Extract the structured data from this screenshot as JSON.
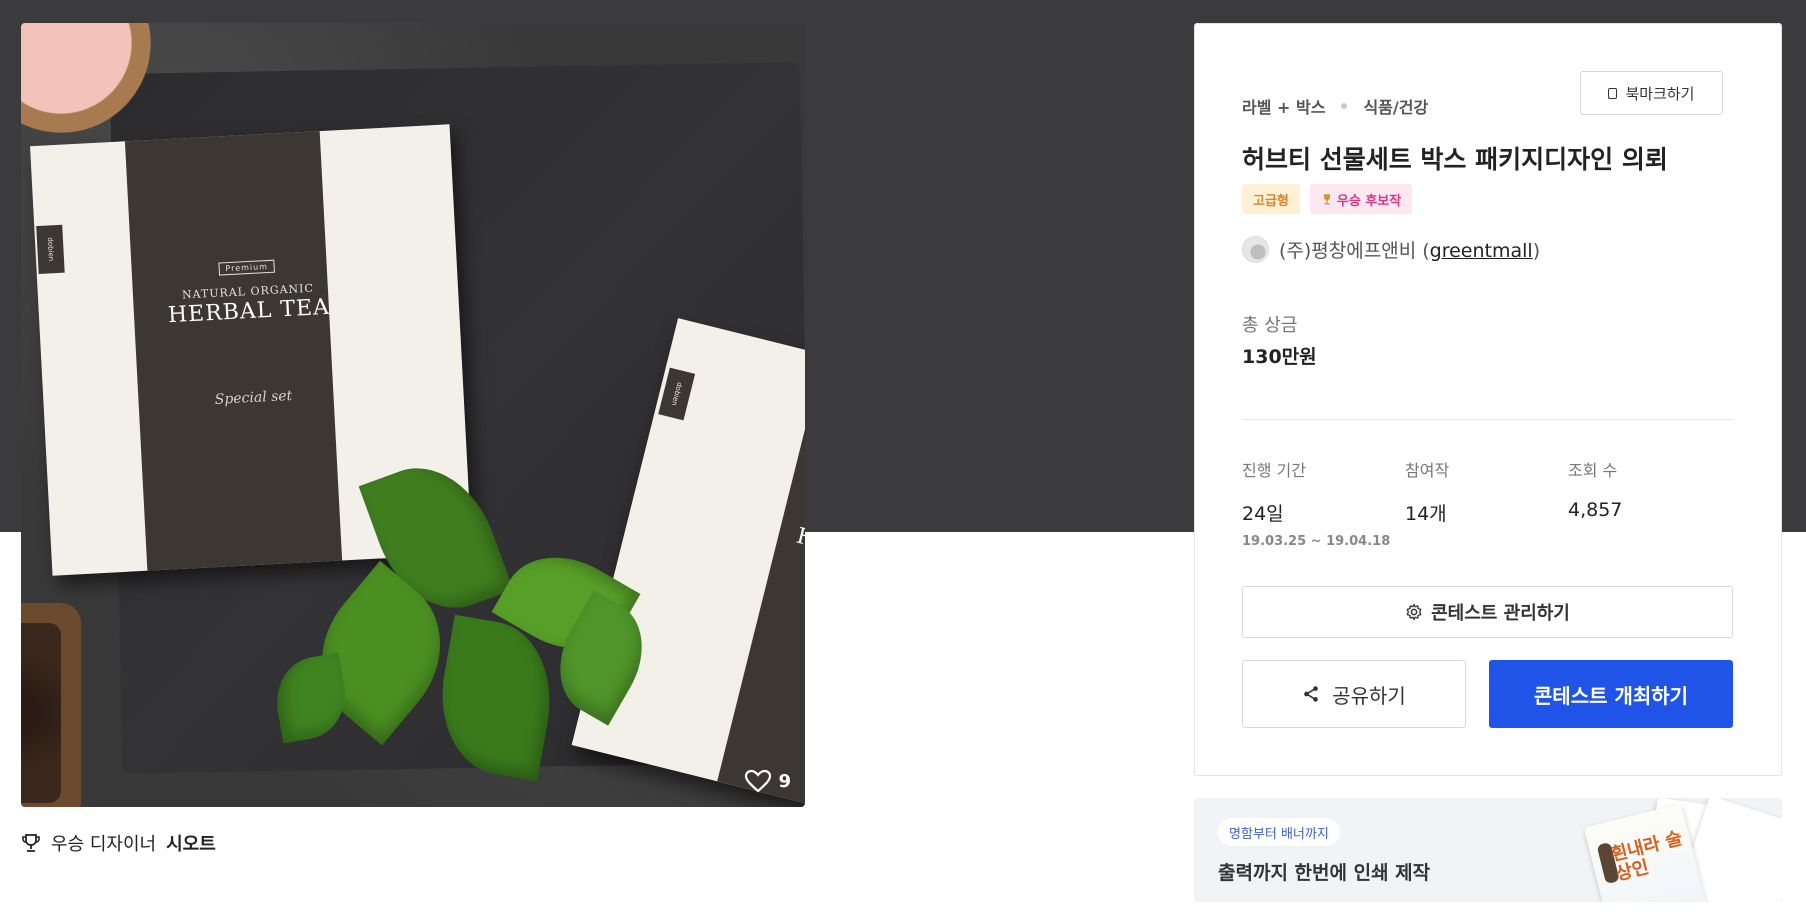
{
  "hero": {
    "like_count": "9",
    "winner_prefix": "우승 디자이너",
    "winner_name": "시오트"
  },
  "product_art": {
    "box_badge": "Premium",
    "box_subtitle": "NATURAL ORGANIC",
    "box_title": "HERBAL TEA",
    "box_brand": "dobien",
    "box_script": "Special set",
    "box_second_title": "HE"
  },
  "card": {
    "bookmark_label": "북마크하기",
    "breadcrumb": [
      "라벨 + 박스",
      "식품/건강"
    ],
    "title": "허브티 선물세트 박스 패키지디자인 의뢰",
    "badges": {
      "premium": "고급형",
      "winner": "우승 후보작"
    },
    "host_company": "(주)평창에프앤비",
    "host_handle": "greentmall",
    "prize_label": "총 상금",
    "prize_value": "130만원",
    "stats": {
      "period_label": "진행 기간",
      "period_value": "24일",
      "period_range": "19.03.25 ~ 19.04.18",
      "entries_label": "참여작",
      "entries_value": "14개",
      "views_label": "조회 수",
      "views_value": "4,857"
    },
    "manage_label": "콘테스트 관리하기",
    "share_label": "공유하기",
    "host_contest_label": "콘테스트 개최하기"
  },
  "ad": {
    "tag": "명함부터 배너까지",
    "text": "출력까지 한번에 인쇄 제작",
    "image_word": "흰내라 술상인"
  },
  "colors": {
    "hero_bg": "#3b3a3c",
    "primary_button": "#2054e8",
    "premium_badge_bg": "#fff1d6",
    "premium_badge_text": "#d9832a",
    "winner_badge_bg": "#fde7f1",
    "winner_badge_text": "#d23a86"
  },
  "icons": [
    "heart-icon",
    "trophy-icon",
    "bookmark-icon",
    "gear-icon",
    "share-icon"
  ]
}
